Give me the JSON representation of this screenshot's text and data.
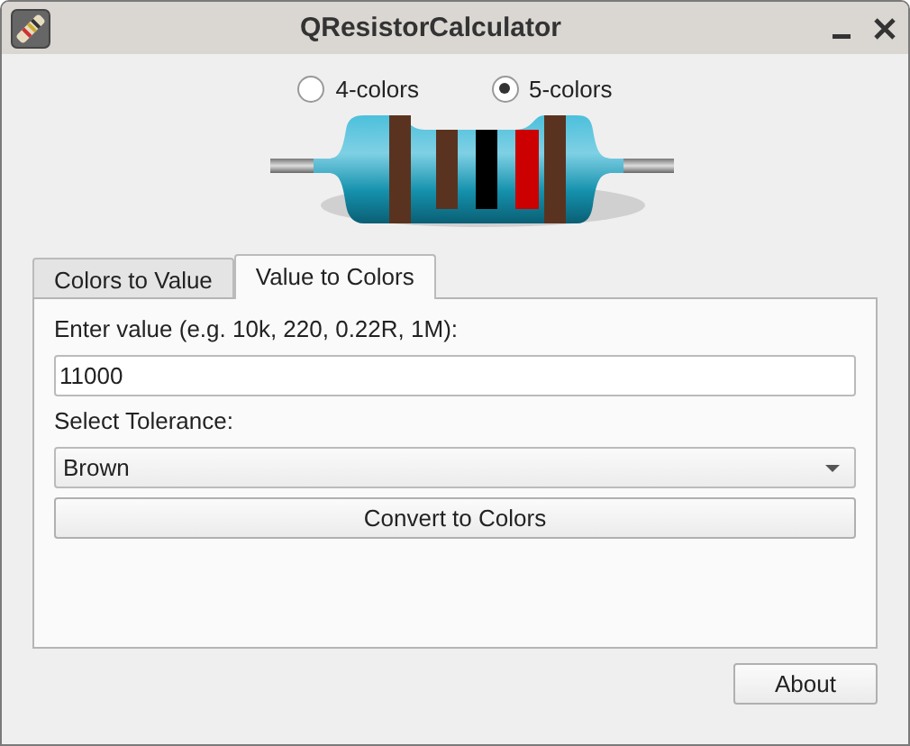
{
  "window": {
    "title": "QResistorCalculator"
  },
  "band_modes": [
    {
      "label": "4-colors",
      "selected": false
    },
    {
      "label": "5-colors",
      "selected": true
    }
  ],
  "resistor": {
    "bands": [
      {
        "color": "#5a3320"
      },
      {
        "color": "#5a3320"
      },
      {
        "color": "#000000"
      },
      {
        "color": "#cc0000"
      },
      {
        "color": "#5a3320"
      }
    ]
  },
  "tabs": [
    {
      "label": "Colors to Value",
      "selected": false
    },
    {
      "label": "Value to Colors",
      "selected": true
    }
  ],
  "value_label": "Enter value (e.g. 10k, 220, 0.22R, 1M):",
  "value_field": {
    "value": "11000"
  },
  "tolerance_label": "Select Tolerance:",
  "tolerance_select": {
    "value": "Brown"
  },
  "convert_button": "Convert to Colors",
  "about_button": "About"
}
